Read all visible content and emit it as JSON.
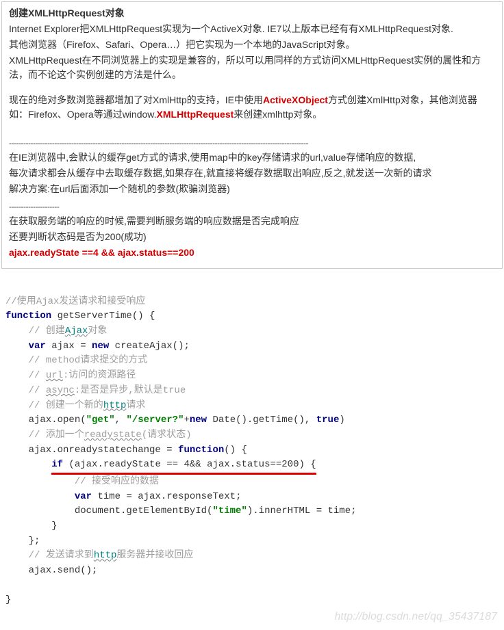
{
  "article": {
    "title": "创建XMLHttpRequest对象",
    "p1": "Internet Explorer把XMLHttpRequest实现为一个ActiveX对象. IE7以上版本已经有有XMLHttpRequest对象.",
    "p2": "其他浏览器（Firefox、Safari、Opera…）把它实现为一个本地的JavaScript对象。",
    "p3": "XMLHttpRequest在不同浏览器上的实现是兼容的，所以可以用同样的方式访问XMLHttpRequest实例的属性和方法，而不论这个实例创建的方法是什么。",
    "p4_pre": "现在的绝对多数浏览器都增加了对XmlHttp的支持，IE中使用",
    "p4_red1": "ActiveXObject",
    "p4_mid": "方式创建XmlHttp对象，其他浏览器如：Firefox、Opera等通过window.",
    "p4_red2": "XMLHttpRequest",
    "p4_post": "来创建xmlhttp对象。",
    "sep": "-----------------------------------------------------------------------------------------------------------------------------",
    "p5": "在IE浏览器中,会默认的缓存get方式的请求,使用map中的key存储请求的url,value存储响应的数据,",
    "p6": "每次请求都会从缓存中去取缓存数据,如果存在,就直接将缓存数据取出响应,反之,就发送一次新的请求",
    "p7": "解决方案:在url后面添加一个随机的参数(欺骗浏览器)",
    "sep2": "---------------------",
    "p8": "在获取服务端的响应的时候,需要判断服务端的响应数据是否完成响应",
    "p9": "还要判断状态码是否为200(成功)",
    "p10_red": " ajax.readyState ==4 && ajax.status==200"
  },
  "code": {
    "c1": "//使用Ajax发送请求和接受响应",
    "c2_kw1": "function",
    "c2_fn": " getServerTime() {",
    "c3": "    // 创建Ajax对象",
    "c3_teal": "Ajax",
    "c4_a": "    ",
    "c4_var": "var",
    "c4_b": " ajax = ",
    "c4_new": "new",
    "c4_c": " createAjax();",
    "c5": "    // method请求提交的方式",
    "c6_a": "    // ",
    "c6_u": "url",
    "c6_b": ":访问的资源路径",
    "c7_a": "    // ",
    "c7_u": "async",
    "c7_b": ":是否是异步,默认是true",
    "c8": "    // 创建一个新的http请求",
    "c8_teal": "http",
    "c9_a": "    ajax.open(",
    "c9_s1": "\"get\"",
    "c9_b": ", ",
    "c9_s2": "\"/server?\"",
    "c9_c": "+",
    "c9_new": "new",
    "c9_d": " Date().getTime(), ",
    "c9_true": "true",
    "c9_e": ")",
    "c10_a": "    // 添加一个",
    "c10_u": "readystate",
    "c10_b": "(请求状态)",
    "c11_a": "    ajax.onreadystatechange = ",
    "c11_fn": "function",
    "c11_b": "() {",
    "c12_a": "        ",
    "c12_if": "if",
    "c12_b": " (ajax.readyState == 4&& ajax.status==200) {",
    "c13": "            // 接受响应的数据",
    "c14_a": "            ",
    "c14_var": "var",
    "c14_b": " time = ajax.responseText;",
    "c15_a": "            document.getElementById(",
    "c15_s": "\"time\"",
    "c15_b": ").innerHTML = time;",
    "c16": "        }",
    "c17": "    };",
    "c18": "    // 发送请求到http服务器并接收回应",
    "c18_teal": "http",
    "c19": "    ajax.send();",
    "c21": "}"
  },
  "watermark": "http://blog.csdn.net/qq_35437187"
}
